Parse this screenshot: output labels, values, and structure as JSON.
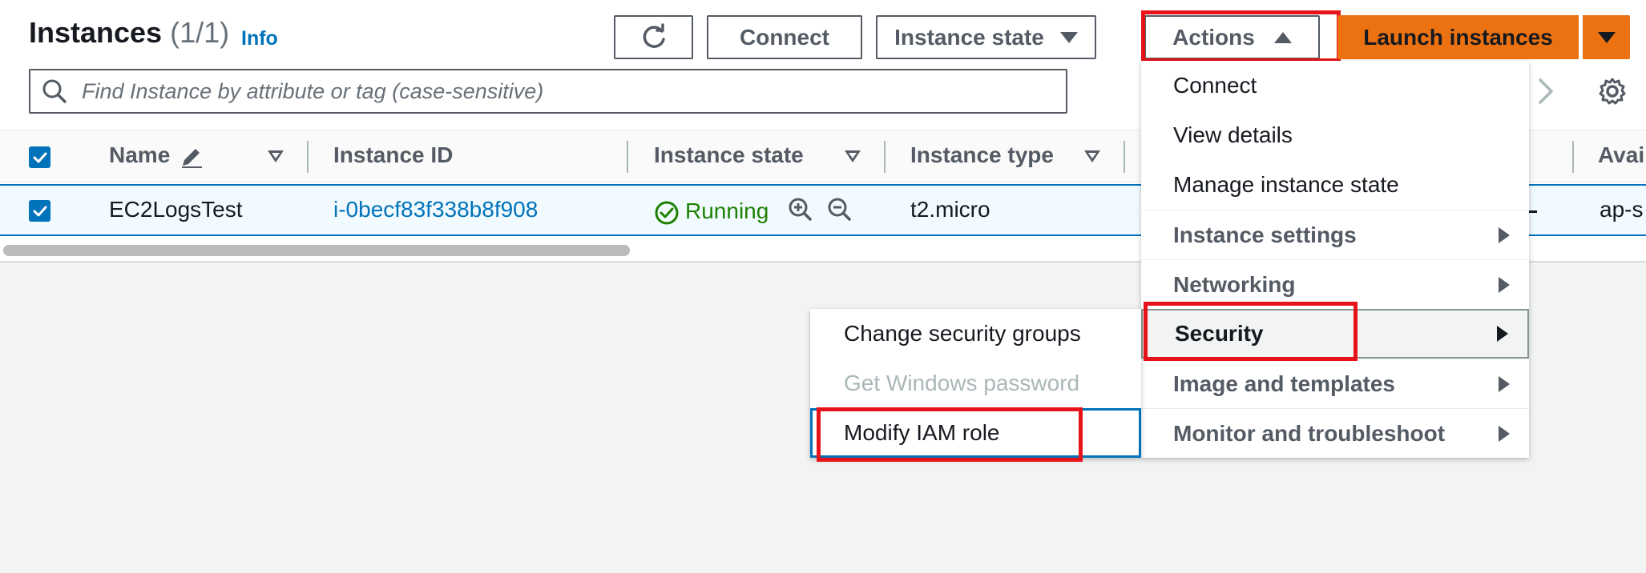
{
  "header": {
    "title": "Instances",
    "count": "(1/1)",
    "info_label": "Info"
  },
  "toolbar": {
    "refresh_icon": "refresh-icon",
    "connect_label": "Connect",
    "instance_state_label": "Instance state",
    "actions_label": "Actions",
    "launch_label": "Launch instances"
  },
  "search": {
    "placeholder": "Find Instance by attribute or tag (case-sensitive)"
  },
  "table": {
    "columns": [
      "Name",
      "Instance ID",
      "Instance state",
      "Instance type",
      "Avai"
    ],
    "rows": [
      {
        "name": "EC2LogsTest",
        "instance_id": "i-0becf83f338b8f908",
        "state": "Running",
        "type": "t2.micro",
        "az": "ap-s"
      }
    ]
  },
  "actions_menu": {
    "items": [
      {
        "label": "Connect"
      },
      {
        "label": "View details"
      },
      {
        "label": "Manage instance state"
      },
      {
        "label": "Instance settings"
      },
      {
        "label": "Networking"
      },
      {
        "label": "Security"
      },
      {
        "label": "Image and templates"
      },
      {
        "label": "Monitor and troubleshoot"
      }
    ]
  },
  "security_submenu": {
    "items": [
      {
        "label": "Change security groups"
      },
      {
        "label": "Get Windows password"
      },
      {
        "label": "Modify IAM role"
      }
    ]
  },
  "colors": {
    "primary_button": "#ec7211",
    "link": "#0073bb",
    "running": "#1d8102",
    "highlight": "#e7131a"
  }
}
